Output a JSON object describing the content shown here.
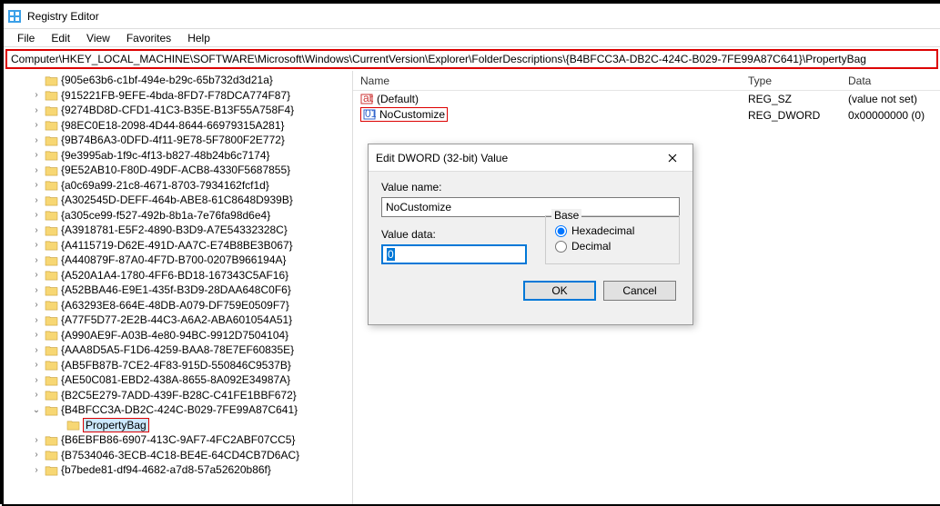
{
  "window": {
    "title": "Registry Editor"
  },
  "menu": {
    "file": "File",
    "edit": "Edit",
    "view": "View",
    "favorites": "Favorites",
    "help": "Help"
  },
  "address": {
    "path": "Computer\\HKEY_LOCAL_MACHINE\\SOFTWARE\\Microsoft\\Windows\\CurrentVersion\\Explorer\\FolderDescriptions\\{B4BFCC3A-DB2C-424C-B029-7FE99A87C641}\\PropertyBag"
  },
  "tree": {
    "items": [
      {
        "exp": "",
        "label": "{905e63b6-c1bf-494e-b29c-65b732d3d21a}"
      },
      {
        "exp": ">",
        "label": "{915221FB-9EFE-4bda-8FD7-F78DCA774F87}"
      },
      {
        "exp": ">",
        "label": "{9274BD8D-CFD1-41C3-B35E-B13F55A758F4}"
      },
      {
        "exp": ">",
        "label": "{98EC0E18-2098-4D44-8644-66979315A281}"
      },
      {
        "exp": ">",
        "label": "{9B74B6A3-0DFD-4f11-9E78-5F7800F2E772}"
      },
      {
        "exp": ">",
        "label": "{9e3995ab-1f9c-4f13-b827-48b24b6c7174}"
      },
      {
        "exp": ">",
        "label": "{9E52AB10-F80D-49DF-ACB8-4330F5687855}"
      },
      {
        "exp": ">",
        "label": "{a0c69a99-21c8-4671-8703-7934162fcf1d}"
      },
      {
        "exp": ">",
        "label": "{A302545D-DEFF-464b-ABE8-61C8648D939B}"
      },
      {
        "exp": ">",
        "label": "{a305ce99-f527-492b-8b1a-7e76fa98d6e4}"
      },
      {
        "exp": ">",
        "label": "{A3918781-E5F2-4890-B3D9-A7E54332328C}"
      },
      {
        "exp": ">",
        "label": "{A4115719-D62E-491D-AA7C-E74B8BE3B067}"
      },
      {
        "exp": ">",
        "label": "{A440879F-87A0-4F7D-B700-0207B966194A}"
      },
      {
        "exp": ">",
        "label": "{A520A1A4-1780-4FF6-BD18-167343C5AF16}"
      },
      {
        "exp": ">",
        "label": "{A52BBA46-E9E1-435f-B3D9-28DAA648C0F6}"
      },
      {
        "exp": ">",
        "label": "{A63293E8-664E-48DB-A079-DF759E0509F7}"
      },
      {
        "exp": ">",
        "label": "{A77F5D77-2E2B-44C3-A6A2-ABA601054A51}"
      },
      {
        "exp": ">",
        "label": "{A990AE9F-A03B-4e80-94BC-9912D7504104}"
      },
      {
        "exp": ">",
        "label": "{AAA8D5A5-F1D6-4259-BAA8-78E7EF60835E}"
      },
      {
        "exp": ">",
        "label": "{AB5FB87B-7CE2-4F83-915D-550846C9537B}"
      },
      {
        "exp": ">",
        "label": "{AE50C081-EBD2-438A-8655-8A092E34987A}"
      },
      {
        "exp": ">",
        "label": "{B2C5E279-7ADD-439F-B28C-C41FE1BBF672}"
      },
      {
        "exp": "v",
        "label": "{B4BFCC3A-DB2C-424C-B029-7FE99A87C641}",
        "expanded": true
      },
      {
        "exp": "",
        "label": "PropertyBag",
        "indent": 3,
        "selected": true
      },
      {
        "exp": ">",
        "label": "{B6EBFB86-6907-413C-9AF7-4FC2ABF07CC5}"
      },
      {
        "exp": ">",
        "label": "{B7534046-3ECB-4C18-BE4E-64CD4CB7D6AC}"
      },
      {
        "exp": ">",
        "label": "{b7bede81-df94-4682-a7d8-57a52620b86f}"
      }
    ]
  },
  "list": {
    "headers": {
      "name": "Name",
      "type": "Type",
      "data": "Data"
    },
    "rows": [
      {
        "icon": "string",
        "name": "(Default)",
        "type": "REG_SZ",
        "data": "(value not set)"
      },
      {
        "icon": "dword",
        "name": "NoCustomize",
        "type": "REG_DWORD",
        "data": "0x00000000 (0)",
        "selected": true
      }
    ]
  },
  "dialog": {
    "title": "Edit DWORD (32-bit) Value",
    "valueNameLabel": "Value name:",
    "valueName": "NoCustomize",
    "valueDataLabel": "Value data:",
    "valueData": "0",
    "baseLabel": "Base",
    "hexLabel": "Hexadecimal",
    "decLabel": "Decimal",
    "baseSelected": "hex",
    "ok": "OK",
    "cancel": "Cancel"
  },
  "colors": {
    "accent": "#0078d7",
    "highlight": "#d00"
  }
}
